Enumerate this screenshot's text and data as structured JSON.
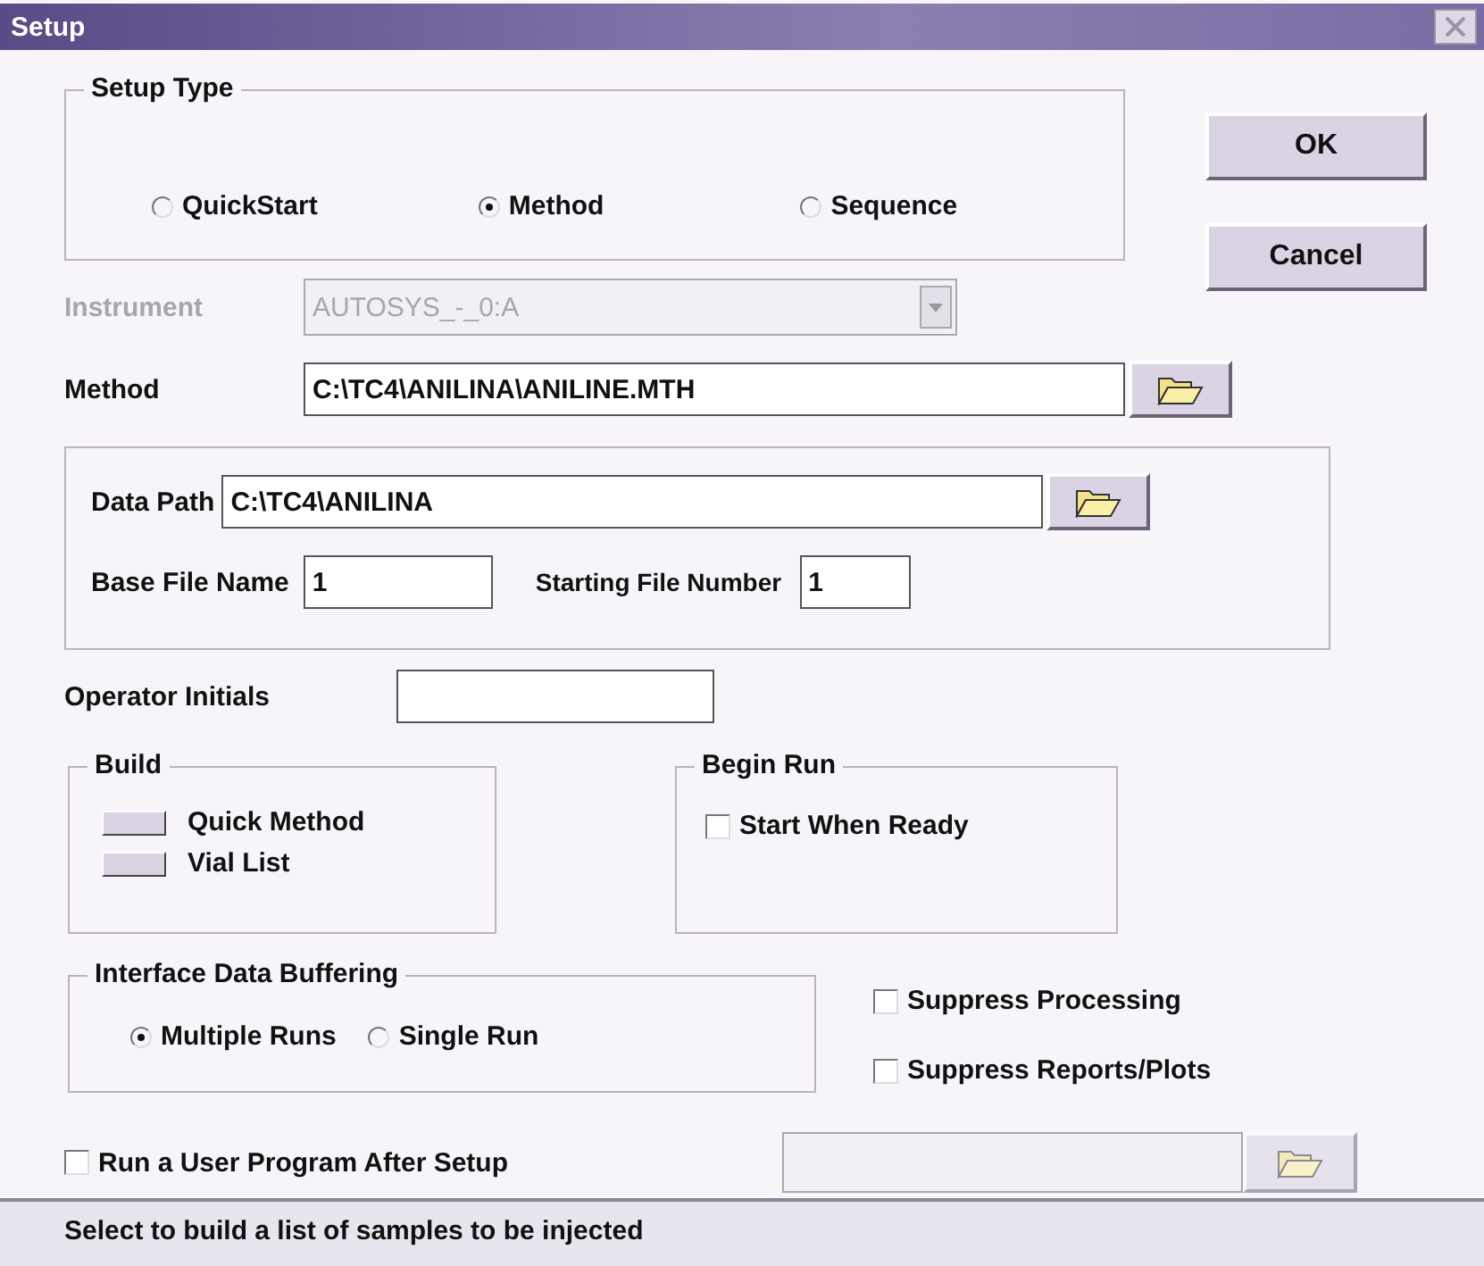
{
  "window": {
    "title": "Setup"
  },
  "setup_type": {
    "label": "Setup Type",
    "options": [
      {
        "label": "QuickStart",
        "selected": false
      },
      {
        "label": "Method",
        "selected": true
      },
      {
        "label": "Sequence",
        "selected": false
      }
    ]
  },
  "buttons": [
    {
      "label": "OK"
    },
    {
      "label": "Cancel"
    }
  ],
  "instrument": {
    "label": "Instrument",
    "value": "AUTOSYS_-_0:A",
    "disabled": true
  },
  "method": {
    "label": "Method",
    "value": "C:\\TC4\\ANILINA\\ANILINE.MTH"
  },
  "data_path": {
    "label": "Data Path",
    "value": "C:\\TC4\\ANILINA"
  },
  "base_file_name": {
    "label": "Base File Name",
    "value": "1"
  },
  "starting_file_number": {
    "label": "Starting File Number",
    "value": "1"
  },
  "operator_initials": {
    "label": "Operator Initials"
  },
  "build": {
    "label": "Build",
    "items": [
      {
        "label": "Quick Method"
      },
      {
        "label": "Vial List"
      }
    ]
  },
  "begin_run": {
    "label": "Begin Run",
    "options": [
      {
        "label": "Start When Ready",
        "checked": false
      }
    ]
  },
  "buffering": {
    "label": "Interface Data Buffering",
    "options": [
      {
        "label": "Multiple Runs",
        "selected": true
      },
      {
        "label": "Single Run",
        "selected": false
      }
    ]
  },
  "suppress": [
    {
      "label": "Suppress Processing",
      "checked": false
    },
    {
      "label": "Suppress Reports/Plots",
      "checked": false
    }
  ],
  "user_program": {
    "label": "Run a User Program After Setup",
    "checked": false,
    "disabled": true
  },
  "status_bar": "Select to build a list of samples to be injected"
}
